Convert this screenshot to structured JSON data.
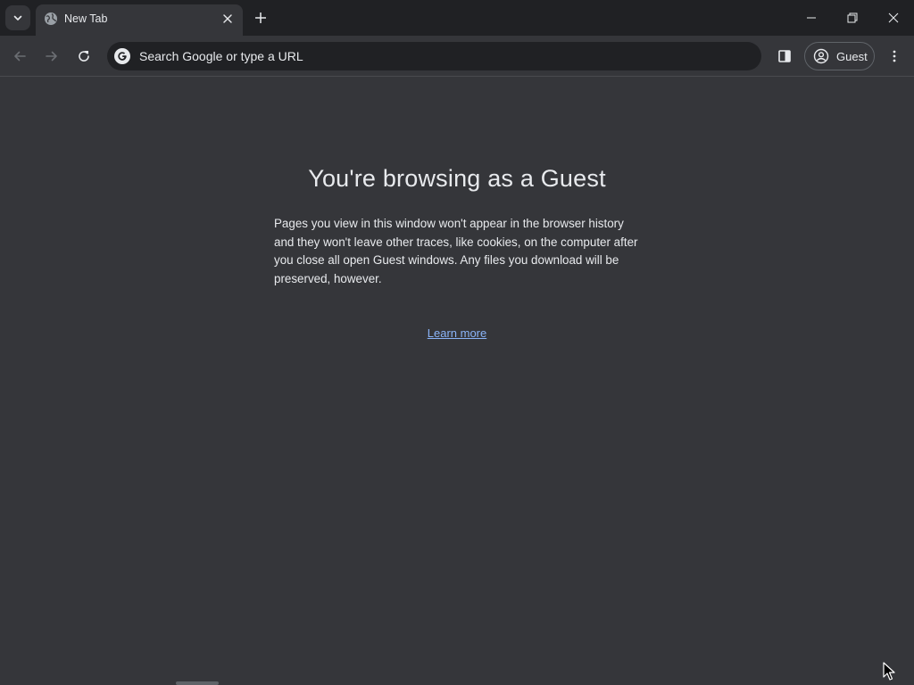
{
  "tab": {
    "title": "New Tab",
    "favicon": "globe-icon"
  },
  "toolbar": {
    "omnibox_placeholder": "Search Google or type a URL",
    "omnibox_value": "",
    "profile_label": "Guest"
  },
  "content": {
    "title": "You're browsing as a Guest",
    "description": "Pages you view in this window won't appear in the browser history and they won't leave other traces, like cookies, on the computer after you close all open Guest windows. Any files you download will be preserved, however.",
    "learn_more": "Learn more"
  },
  "colors": {
    "frame": "#202124",
    "surface": "#35363a",
    "text": "#e8eaed",
    "link": "#8ab4f8"
  }
}
